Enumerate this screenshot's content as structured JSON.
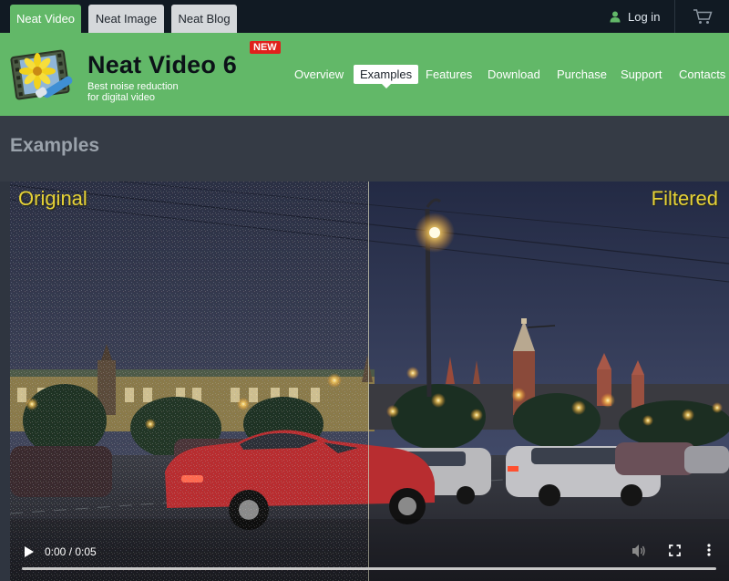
{
  "top_tabs": [
    {
      "label": "Neat Video",
      "active": true
    },
    {
      "label": "Neat Image",
      "active": false
    },
    {
      "label": "Neat Blog",
      "active": false
    }
  ],
  "account": {
    "login_label": "Log in",
    "login_icon": "user-icon",
    "cart_icon": "cart-icon"
  },
  "header": {
    "product_name": "Neat Video 6",
    "badge": "NEW",
    "tagline_line1": "Best noise reduction",
    "tagline_line2": "for digital video"
  },
  "nav": [
    {
      "label": "Overview",
      "active": false
    },
    {
      "label": "Examples",
      "active": true
    },
    {
      "label": "Features",
      "active": false
    },
    {
      "label": "Download",
      "active": false
    },
    {
      "label": "Purchase",
      "active": false
    },
    {
      "label": "Support",
      "active": false
    },
    {
      "label": "Contacts",
      "active": false
    }
  ],
  "page_title": "Examples",
  "video": {
    "left_caption": "Original",
    "right_caption": "Filtered",
    "time_display": "0:00 / 0:05",
    "progress": 0
  },
  "colors": {
    "brand_green": "#62b868",
    "top_bar": "#111a23",
    "caption_yellow": "#e6d238",
    "badge_red": "#e0201c"
  }
}
